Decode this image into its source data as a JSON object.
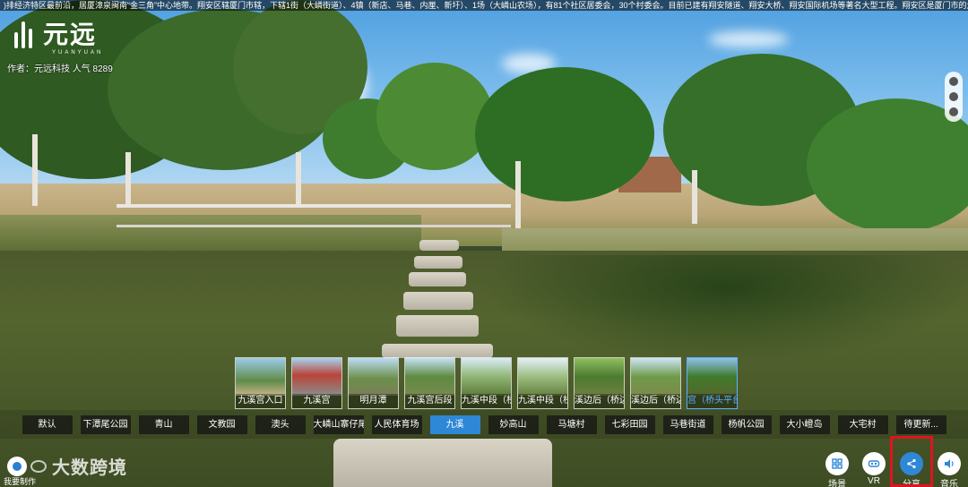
{
  "marquee": {
    "text": ")排经济特区最前沿，居厦漳泉闽南“金三角”中心地带。翔安区辖厦门市辖，下辖1街（大嶙街道）、4镇（新店、马巷、内厘、新圩）、1场（大嶙山农场），有81个社区居委会，30个村委会。目前已建有翔安隧道、翔安大桥、翔安国际机场等著名大型工程。翔安区是厦门市的六大行政区"
  },
  "logo": {
    "text": "元远",
    "sub": "YUANYUAN"
  },
  "author": "作者：元远科技  人气 8289",
  "thumbnails": [
    {
      "label": "九溪宫入口"
    },
    {
      "label": "九溪宫"
    },
    {
      "label": "明月潭"
    },
    {
      "label": "九溪宫后段"
    },
    {
      "label": "九溪中段（桥"
    },
    {
      "label": "九溪中段（桥"
    },
    {
      "label": "溪边后（桥边"
    },
    {
      "label": "溪边后（桥边"
    },
    {
      "label": "宫（桥头平台）"
    }
  ],
  "categories": [
    {
      "label": "默认"
    },
    {
      "label": "下潭尾公园"
    },
    {
      "label": "青山"
    },
    {
      "label": "文教园"
    },
    {
      "label": "澳头"
    },
    {
      "label": "大嶙山寨仔尾"
    },
    {
      "label": "人民体育场"
    },
    {
      "label": "九溪"
    },
    {
      "label": "妙高山"
    },
    {
      "label": "马塘村"
    },
    {
      "label": "七彩田园"
    },
    {
      "label": "马巷街道"
    },
    {
      "label": "杨帆公园"
    },
    {
      "label": "大小嶝岛"
    },
    {
      "label": "大宅村"
    },
    {
      "label": "待更新..."
    }
  ],
  "active_category_index": 7,
  "brand": {
    "text": "大数跨境",
    "made_by": "我要制作"
  },
  "bottom_buttons": {
    "scene": "场景",
    "vr": "VR",
    "share": "分享",
    "music": "音乐"
  },
  "colors": {
    "accent": "#2e88d6",
    "highlight_box": "#e0141e"
  }
}
